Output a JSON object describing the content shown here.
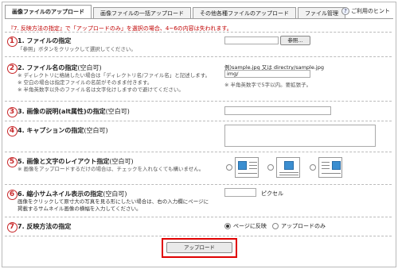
{
  "tabs": [
    {
      "label": "画像ファイルのアップロード",
      "active": true
    },
    {
      "label": "画像ファイルの一括アップロード",
      "active": false
    },
    {
      "label": "その他各種ファイルのアップロード",
      "active": false
    },
    {
      "label": "ファイル管理",
      "active": false
    }
  ],
  "help": {
    "label": "ご利用のヒント",
    "icon": "question-circle-icon"
  },
  "warning": "『7. 反映方法の指定』で「アップロードのみ」を選択の場合、4~6の内容は失われます。",
  "sections": {
    "s1": {
      "num": "1",
      "title": "1. ファイルの指定",
      "note": "「参照」ボタンをクリックして選択してください。",
      "browse_label": "参照..."
    },
    "s2": {
      "num": "2",
      "title": "2. ファイル名の指定",
      "title_opt": "(空白可)",
      "note1": "※ ディレクトリに格納したい場合は「ディレクトリ名/ファイル名」と記述します。",
      "note2": "※ 空白の場合は指定ファイルの名前がそのまま付きます。",
      "note3": "※ 半角英数字以外のファイル名は文字化けしますので避けてください。",
      "example": "例)sample.jpg 又は directry/sample.jpg",
      "example_field": "img/",
      "example_note": "※ 半角英数字で5字以内。要拡張子。"
    },
    "s3": {
      "num": "3",
      "title": "3. 画像の説明(alt属性)の指定",
      "title_opt": "(空白可)"
    },
    "s4": {
      "num": "4",
      "title": "4. キャプションの指定",
      "title_opt": "(空白可)"
    },
    "s5": {
      "num": "5",
      "title": "5. 画像と文字のレイアウト指定",
      "title_opt": "(空白可)",
      "note": "※ 画像をアップロードするだけの場合は、チェックを入れなくても構いません。"
    },
    "s6": {
      "num": "6",
      "title": "6. 縮小サムネイル表示の指定",
      "title_opt": "(空白可)",
      "note1": "画像をクリックして原寸大の写真を見る形にしたい場合は、右の入力欄にページに",
      "note2": "掲載するサムネイル画像の横幅を入力してください。",
      "unit": "ピクセル"
    },
    "s7": {
      "num": "7",
      "title": "7. 反映方法の指定",
      "opt_page": "ページに反映",
      "opt_upload": "アップロードのみ",
      "selected": "ページに反映"
    }
  },
  "upload_button": "アップロード",
  "colors": {
    "accent_red": "#c8282a",
    "highlight": "#e00000",
    "image_blue": "#3b8ed0"
  }
}
